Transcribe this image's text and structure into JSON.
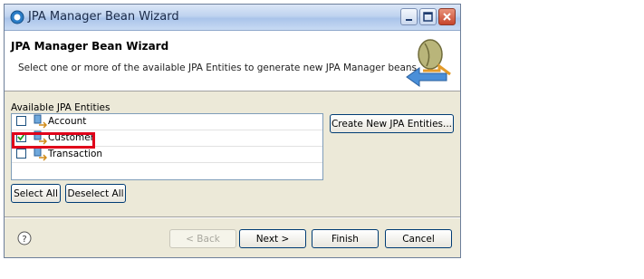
{
  "window": {
    "title": "JPA Manager Bean Wizard"
  },
  "header": {
    "title": "JPA Manager Bean Wizard",
    "description": "Select one or more of the available JPA Entities to generate new JPA Manager beans."
  },
  "entities": {
    "label": "Available JPA Entities",
    "items": [
      {
        "name": "Account",
        "checked": false
      },
      {
        "name": "Customer",
        "checked": true
      },
      {
        "name": "Transaction",
        "checked": false
      }
    ]
  },
  "buttons": {
    "create_new": "Create New JPA Entities...",
    "select_all": "Select All",
    "deselect_all": "Deselect All",
    "back": "< Back",
    "next": "Next >",
    "finish": "Finish",
    "cancel": "Cancel"
  },
  "colors": {
    "highlight": "#e0001a",
    "accent": "#003c74"
  },
  "icons": [
    "app-icon",
    "minimize-icon",
    "maximize-icon",
    "close-icon",
    "wizard-banner-icon",
    "entity-icon",
    "help-icon"
  ]
}
